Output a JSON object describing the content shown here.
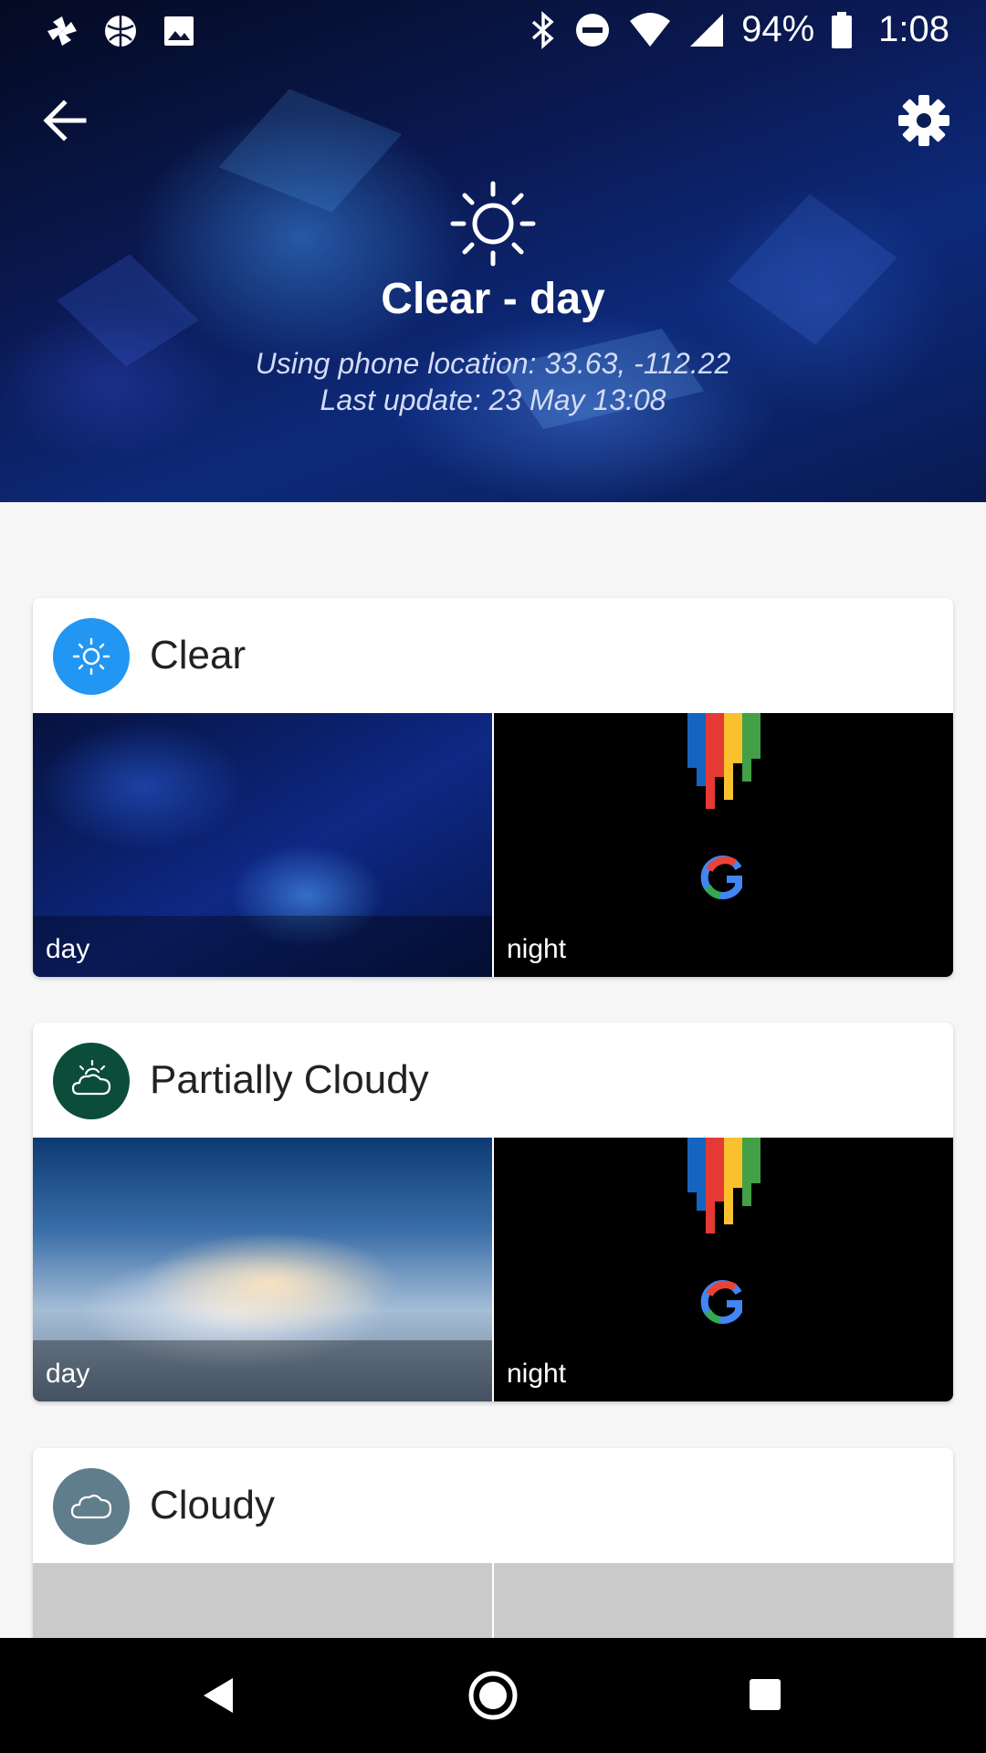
{
  "status_bar": {
    "battery": "94%",
    "time": "1:08",
    "left_icons": [
      "pinwheel-icon",
      "basketball-icon",
      "image-icon"
    ],
    "right_icons": [
      "bluetooth-icon",
      "do-not-disturb-icon",
      "wifi-icon",
      "signal-icon",
      "battery-icon"
    ]
  },
  "header": {
    "title": "Clear - day",
    "location": "Using phone location: 33.63, -112.22",
    "last_update": "Last update: 23 May 13:08",
    "back_icon": "arrow-back-icon",
    "settings_icon": "gear-icon",
    "weather_icon": "sun-icon"
  },
  "cards": [
    {
      "title": "Clear",
      "badge_color": "#2196F3",
      "icon": "sun-icon",
      "images": [
        {
          "label": "day"
        },
        {
          "label": "night"
        }
      ]
    },
    {
      "title": "Partially Cloudy",
      "badge_color": "#0B4D3A",
      "icon": "partly-cloudy-icon",
      "images": [
        {
          "label": "day"
        },
        {
          "label": "night"
        }
      ]
    },
    {
      "title": "Cloudy",
      "badge_color": "#607D8B",
      "icon": "cloud-icon",
      "images": [
        {
          "label": ""
        },
        {
          "label": ""
        }
      ]
    }
  ],
  "nav_bar": {
    "icons": [
      "back-triangle-icon",
      "home-circle-icon",
      "recents-square-icon"
    ]
  }
}
